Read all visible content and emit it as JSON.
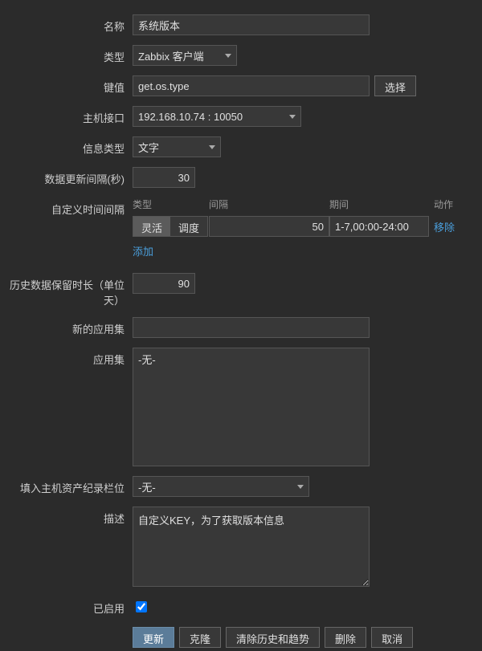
{
  "labels": {
    "name": "名称",
    "type": "类型",
    "key": "键值",
    "host_if": "主机接口",
    "info_type": "信息类型",
    "update_interval": "数据更新间隔(秒)",
    "custom_intervals": "自定义时间间隔",
    "history_days": "历史数据保留时长（单位天）",
    "new_app": "新的应用集",
    "apps": "应用集",
    "inventory": "填入主机资产纪录栏位",
    "desc": "描述",
    "enabled": "已启用"
  },
  "values": {
    "name": "系统版本",
    "type": "Zabbix 客户端",
    "key": "get.os.type",
    "host_if": "192.168.10.74 : 10050",
    "info_type": "文字",
    "update_interval": "30",
    "history_days": "90",
    "apps_option": "-无-",
    "inventory": "-无-",
    "desc": "自定义KEY，为了获取版本信息",
    "enabled": true
  },
  "custom_intervals": {
    "headers": {
      "type": "类型",
      "interval": "间隔",
      "period": "期间",
      "action": "动作"
    },
    "seg": {
      "flex": "灵活",
      "sched": "调度"
    },
    "row": {
      "interval": "50",
      "period": "1-7,00:00-24:00"
    },
    "remove": "移除",
    "add": "添加"
  },
  "buttons": {
    "select": "选择",
    "update": "更新",
    "clone": "克隆",
    "clear": "清除历史和趋势",
    "delete": "删除",
    "cancel": "取消"
  }
}
